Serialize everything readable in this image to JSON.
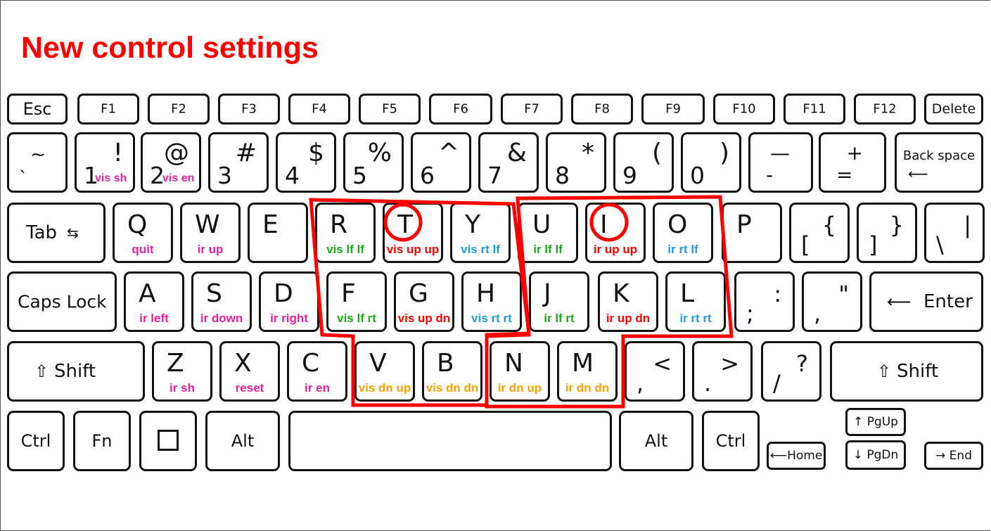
{
  "title": "New control settings",
  "colors": {
    "title": "#ff0000",
    "pink": "#e6219b",
    "green": "#1aa81a",
    "red": "#ff0000",
    "blue": "#1f9be0",
    "orange": "#f5a200"
  },
  "row_fn": [
    "Esc",
    "F1",
    "F2",
    "F3",
    "F4",
    "F5",
    "F6",
    "F7",
    "F8",
    "F9",
    "F10",
    "F11",
    "F12",
    "Delete"
  ],
  "row_num": [
    {
      "up": "~",
      "low": "`",
      "sub": ""
    },
    {
      "up": "!",
      "low": "1",
      "sub": "vis sh"
    },
    {
      "up": "@",
      "low": "2",
      "sub": "vis en"
    },
    {
      "up": "#",
      "low": "3",
      "sub": ""
    },
    {
      "up": "$",
      "low": "4",
      "sub": ""
    },
    {
      "up": "%",
      "low": "5",
      "sub": ""
    },
    {
      "up": "^",
      "low": "6",
      "sub": ""
    },
    {
      "up": "&",
      "low": "7",
      "sub": ""
    },
    {
      "up": "*",
      "low": "8",
      "sub": ""
    },
    {
      "up": "(",
      "low": "9",
      "sub": ""
    },
    {
      "up": ")",
      "low": "0",
      "sub": ""
    },
    {
      "up": "—",
      "low": "-",
      "sub": ""
    },
    {
      "up": "+",
      "low": "=",
      "sub": ""
    }
  ],
  "backspace": "Back space",
  "tab": "Tab",
  "row_q": [
    {
      "k": "Q",
      "sub": "quit"
    },
    {
      "k": "W",
      "sub": "ir up"
    },
    {
      "k": "E",
      "sub": ""
    },
    {
      "k": "R",
      "sub": "vis lf lf"
    },
    {
      "k": "T",
      "sub": "vis up up"
    },
    {
      "k": "Y",
      "sub": "vis rt lf"
    },
    {
      "k": "U",
      "sub": "ir lf lf"
    },
    {
      "k": "I",
      "sub": "ir up up"
    },
    {
      "k": "O",
      "sub": "ir rt lf"
    },
    {
      "k": "P",
      "sub": ""
    }
  ],
  "brackets": [
    {
      "up": "{",
      "low": "["
    },
    {
      "up": "}",
      "low": "]"
    },
    {
      "up": "|",
      "low": "\\"
    }
  ],
  "caps": "Caps Lock",
  "row_a": [
    {
      "k": "A",
      "sub": "ir left"
    },
    {
      "k": "S",
      "sub": "ir down"
    },
    {
      "k": "D",
      "sub": "ir right"
    },
    {
      "k": "F",
      "sub": "vis lf rt"
    },
    {
      "k": "G",
      "sub": "vis up dn"
    },
    {
      "k": "H",
      "sub": "vis rt rt"
    },
    {
      "k": "J",
      "sub": "ir lf rt"
    },
    {
      "k": "K",
      "sub": "ir up dn"
    },
    {
      "k": "L",
      "sub": "ir rt rt"
    }
  ],
  "semi": [
    {
      "up": ":",
      "low": ";"
    },
    {
      "up": "\"",
      "low": ","
    }
  ],
  "enter": "Enter",
  "shift": "Shift",
  "row_z": [
    {
      "k": "Z",
      "sub": "ir sh"
    },
    {
      "k": "X",
      "sub": "reset"
    },
    {
      "k": "C",
      "sub": "ir en"
    },
    {
      "k": "V",
      "sub": "vis dn up"
    },
    {
      "k": "B",
      "sub": "vis dn dn"
    },
    {
      "k": "N",
      "sub": "ir dn up"
    },
    {
      "k": "M",
      "sub": "ir dn dn"
    }
  ],
  "punct": [
    {
      "up": "<",
      "low": ","
    },
    {
      "up": ">",
      "low": "."
    },
    {
      "up": "?",
      "low": "/"
    }
  ],
  "bottom": {
    "ctrl": "Ctrl",
    "fn": "Fn",
    "win": "☐",
    "alt": "Alt",
    "alt_r": "Alt",
    "ctrl_r": "Ctrl",
    "home": "Home",
    "pgup": "PgUp",
    "pgdn": "PgDn",
    "end": "End"
  }
}
